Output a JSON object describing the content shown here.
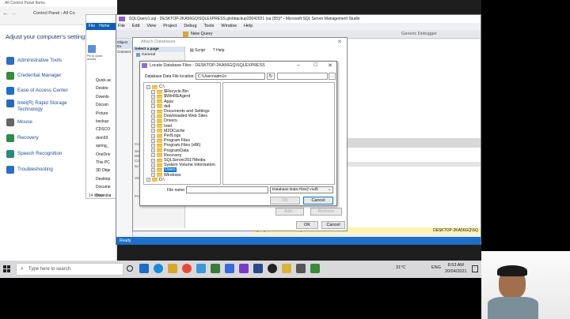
{
  "control_panel": {
    "title": "All Control Panel Items",
    "breadcrumb": "Control Panel › All Co",
    "heading": "Adjust your computer's settings",
    "items": [
      {
        "label": "Administrative Tools",
        "color": "#2f6fbf"
      },
      {
        "label": "Credential Manager",
        "color": "#3a8a3a"
      },
      {
        "label": "Ease of Access Center",
        "color": "#1d6fc9"
      },
      {
        "label": "Intel(R) Rapid Storage Technology",
        "color": "#2a68b8"
      },
      {
        "label": "Mouse",
        "color": "#666666"
      },
      {
        "label": "Recovery",
        "color": "#2f8a4f"
      },
      {
        "label": "Speech Recognition",
        "color": "#2a8a7a"
      },
      {
        "label": "Troubleshooting",
        "color": "#2f6fbf"
      }
    ]
  },
  "explorer": {
    "ribbon": [
      "File",
      "Home"
    ],
    "quick": "Pin to Quick access",
    "nav": [
      "Quick ac",
      "Deskto",
      "Downlo",
      "Docum",
      "Picture",
      "backup",
      "CDSCO",
      "dom93",
      "spring_",
      "OneDriv",
      "This PC",
      "3D Obje",
      "Desktop",
      "Docume",
      "Downloa"
    ],
    "status": "14 items"
  },
  "ssms": {
    "title": "SQLQuery1.sql - DESKTOP-2KA56GQ\\SQLEXPRESS.globbackup20042021 (sa (55))* - Microsoft SQL Server Management Studio",
    "menu": [
      "File",
      "Edit",
      "View",
      "Project",
      "Debug",
      "Tools",
      "Window",
      "Help"
    ],
    "new_query": "New Query",
    "debugger": "Generic Debugger",
    "object_explorer": "Object Ex",
    "connect": "Connect",
    "status_left": "Ready",
    "query_status": "Query executed successfully.",
    "server_status": "DESKTOP-2KA56GQ\\SQ"
  },
  "attach": {
    "title": "Attach Databases",
    "select_page": "Select a page",
    "general": "General",
    "script": "Script",
    "help": "Help",
    "side_labels": [
      "Conn",
      "Serv",
      "DES",
      "Conn",
      "sa",
      "View",
      "Prog"
    ],
    "add": "Add...",
    "remove": "Remove",
    "ok": "OK",
    "cancel": "Cancel"
  },
  "locate": {
    "title": "Locate Database Files - DESKTOP-2KA56GQ\\SQLEXPRESS",
    "location_label": "Database Data File location:",
    "location_value": "C:\\Users\\adm1n",
    "tree": [
      {
        "label": "C:\\",
        "level": 0,
        "expand": "−"
      },
      {
        "label": "$Recycle.Bin",
        "level": 1,
        "expand": "+"
      },
      {
        "label": "$WinREAgent",
        "level": 1,
        "expand": "+"
      },
      {
        "label": "Apps",
        "level": 1,
        "expand": "+"
      },
      {
        "label": "dell",
        "level": 1,
        "expand": "+"
      },
      {
        "label": "Documents and Settings",
        "level": 1,
        "expand": "+"
      },
      {
        "label": "Downloaded Web Sites",
        "level": 1,
        "expand": "+"
      },
      {
        "label": "Drivers",
        "level": 1,
        "expand": "+"
      },
      {
        "label": "Intel",
        "level": 1,
        "expand": "+"
      },
      {
        "label": "M2DCache",
        "level": 1,
        "expand": "+"
      },
      {
        "label": "PerfLogs",
        "level": 1,
        "expand": "+"
      },
      {
        "label": "Program Files",
        "level": 1,
        "expand": "+"
      },
      {
        "label": "Program Files (x86)",
        "level": 1,
        "expand": "+"
      },
      {
        "label": "ProgramData",
        "level": 1,
        "expand": "+"
      },
      {
        "label": "Recovery",
        "level": 1,
        "expand": "+"
      },
      {
        "label": "SQLServer2017Media",
        "level": 1,
        "expand": "+"
      },
      {
        "label": "System Volume Information",
        "level": 1,
        "expand": "+"
      },
      {
        "label": "Users",
        "level": 1,
        "expand": "+",
        "selected": true
      },
      {
        "label": "Windows",
        "level": 1,
        "expand": "+"
      },
      {
        "label": "D:\\",
        "level": 0,
        "expand": "+"
      }
    ],
    "file_name_label": "File name:",
    "file_type": "Database Data Files(*.mdf)",
    "ok": "OK",
    "cancel": "Cancel"
  },
  "taskbar": {
    "search_placeholder": "Type here to search",
    "temp": "31°C",
    "lang": "ENG",
    "time": "8:53 AM",
    "date": "20/04/2021"
  },
  "colors": {
    "accent": "#0078d7",
    "selection": "#0078d7",
    "ssms_chrome": "#eef0f5"
  }
}
